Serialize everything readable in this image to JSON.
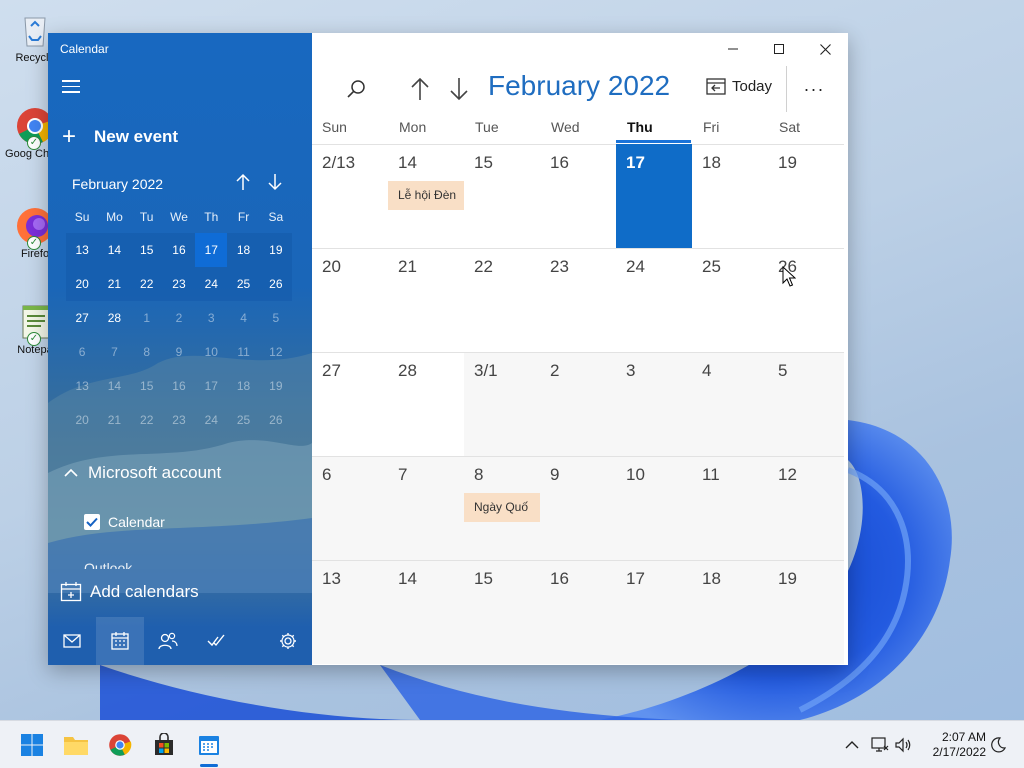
{
  "desktop": {
    "icons": [
      {
        "label": "Recycle",
        "icon": "recycle-bin-icon"
      },
      {
        "label": "Goog Chron",
        "icon": "chrome-icon"
      },
      {
        "label": "Firefo",
        "icon": "firefox-icon"
      },
      {
        "label": "Notepa",
        "icon": "notepad-icon"
      }
    ]
  },
  "window": {
    "app_title": "Calendar",
    "controls": [
      "minimize-icon",
      "maximize-icon",
      "close-icon"
    ]
  },
  "sidebar": {
    "new_event_label": "New event",
    "mini_calendar": {
      "month_label": "February 2022",
      "weekdays": [
        "Su",
        "Mo",
        "Tu",
        "We",
        "Th",
        "Fr",
        "Sa"
      ],
      "today": "17",
      "rows": [
        [
          "13",
          "14",
          "15",
          "16",
          "17",
          "18",
          "19"
        ],
        [
          "20",
          "21",
          "22",
          "23",
          "24",
          "25",
          "26"
        ],
        [
          "27",
          "28",
          "1",
          "2",
          "3",
          "4",
          "5"
        ],
        [
          "6",
          "7",
          "8",
          "9",
          "10",
          "11",
          "12"
        ],
        [
          "13",
          "14",
          "15",
          "16",
          "17",
          "18",
          "19"
        ],
        [
          "20",
          "21",
          "22",
          "23",
          "24",
          "25",
          "26"
        ]
      ]
    },
    "account_section": "Microsoft account",
    "calendar_item": "Calendar",
    "outlook_peek": "Outlook",
    "add_calendars_label": "Add calendars",
    "bottom_nav": [
      "mail-icon",
      "calendar-icon",
      "people-icon",
      "todo-icon",
      "settings-icon"
    ]
  },
  "main": {
    "month_title": "February 2022",
    "today_label": "Today",
    "more_label": "···",
    "weekdays": [
      "Sun",
      "Mon",
      "Tue",
      "Wed",
      "Thu",
      "Fri",
      "Sat"
    ],
    "current_weekday": "Thu",
    "weeks": [
      [
        "2/13",
        "14",
        "15",
        "16",
        "17",
        "18",
        "19"
      ],
      [
        "20",
        "21",
        "22",
        "23",
        "24",
        "25",
        "26"
      ],
      [
        "27",
        "28",
        "3/1",
        "2",
        "3",
        "4",
        "5"
      ],
      [
        "6",
        "7",
        "8",
        "9",
        "10",
        "11",
        "12"
      ],
      [
        "13",
        "14",
        "15",
        "16",
        "17",
        "18",
        "19"
      ]
    ],
    "events": [
      {
        "title": "Lễ hội Đèn",
        "color": "#f9dfc6"
      },
      {
        "title": "Ngày Quố",
        "color": "#f9dfc6"
      }
    ],
    "accent_color": "#0f6cc8"
  },
  "taskbar": {
    "apps": [
      "start-icon",
      "file-explorer-icon",
      "chrome-icon",
      "store-icon",
      "calendar-icon"
    ],
    "tray": [
      "chevron-up-icon",
      "network-icon",
      "volume-icon"
    ],
    "time": "2:07 AM",
    "date": "2/17/2022"
  }
}
